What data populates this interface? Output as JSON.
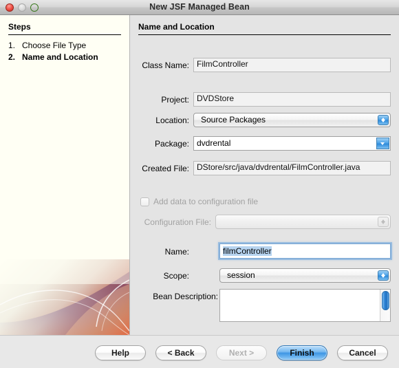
{
  "window": {
    "title": "New JSF Managed Bean",
    "traffic_lights": [
      "close",
      "minimize",
      "zoom"
    ]
  },
  "sidebar": {
    "heading": "Steps",
    "steps": [
      {
        "number": "1.",
        "label": "Choose File Type",
        "current": false
      },
      {
        "number": "2.",
        "label": "Name and Location",
        "current": true
      }
    ]
  },
  "main": {
    "heading": "Name and Location",
    "fields": {
      "class_name": {
        "label": "Class Name:",
        "value": "FilmController"
      },
      "project": {
        "label": "Project:",
        "value": "DVDStore"
      },
      "location": {
        "label": "Location:",
        "value": "Source Packages"
      },
      "package": {
        "label": "Package:",
        "value": "dvdrental"
      },
      "created_file": {
        "label": "Created File:",
        "value": "DStore/src/java/dvdrental/FilmController.java"
      },
      "add_to_config": {
        "label": "Add data to configuration file",
        "checked": false,
        "enabled": false
      },
      "configuration_file": {
        "label": "Configuration File:",
        "value": "",
        "enabled": false
      },
      "name": {
        "label": "Name:",
        "value": "filmController",
        "focused": true,
        "selected": true
      },
      "scope": {
        "label": "Scope:",
        "value": "session"
      },
      "bean_description": {
        "label": "Bean Description:",
        "value": ""
      }
    }
  },
  "buttons": {
    "help": {
      "label": "Help",
      "enabled": true,
      "default": false
    },
    "back": {
      "label": "< Back",
      "enabled": true,
      "default": false
    },
    "next": {
      "label": "Next >",
      "enabled": false,
      "default": false
    },
    "finish": {
      "label": "Finish",
      "enabled": true,
      "default": true
    },
    "cancel": {
      "label": "Cancel",
      "enabled": true,
      "default": false
    }
  },
  "colors": {
    "accent_blue": "#3e96e4",
    "sidebar_bg": "#fffff4",
    "panel_bg": "#e4e4e4",
    "selection": "#b6d3ef"
  }
}
